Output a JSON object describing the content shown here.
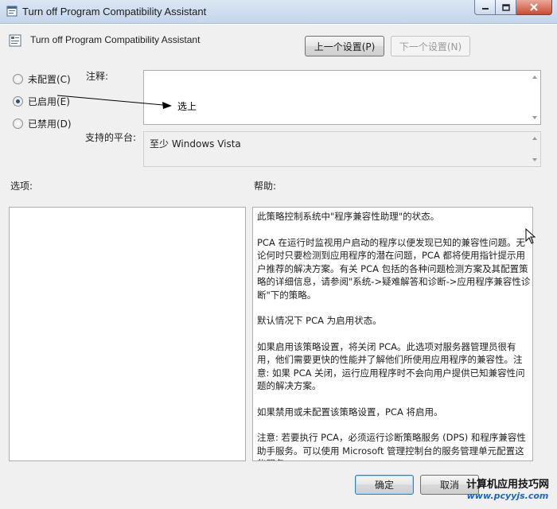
{
  "window": {
    "title": "Turn off Program Compatibility Assistant"
  },
  "header": {
    "policy_name": "Turn off Program Compatibility Assistant",
    "prev_button": "上一个设置(P)",
    "next_button": "下一个设置(N)"
  },
  "state_options": [
    {
      "label": "未配置(C)",
      "checked": false
    },
    {
      "label": "已启用(E)",
      "checked": true
    },
    {
      "label": "已禁用(D)",
      "checked": false
    }
  ],
  "comment": {
    "label": "注释:",
    "value": ""
  },
  "platform": {
    "label": "支持的平台:",
    "value": "至少 Windows Vista"
  },
  "options_section": {
    "label": "选项:"
  },
  "help_section": {
    "label": "帮助:",
    "paragraphs": [
      "此策略控制系统中\"程序兼容性助理\"的状态。",
      "PCA 在运行时监视用户启动的程序以便发现已知的兼容性问题。无论何时只要检测到应用程序的潜在问题，PCA 都将使用指针提示用户推荐的解决方案。有关 PCA 包括的各种问题检测方案及其配置策略的详细信息，请参阅\"系统->疑难解答和诊断->应用程序兼容性诊断\"下的策略。",
      "默认情况下 PCA 为启用状态。",
      "如果启用该策略设置，将关闭 PCA。此选项对服务器管理员很有用，他们需要更快的性能并了解他们所使用应用程序的兼容性。注意: 如果 PCA 关闭，运行应用程序时不会向用户提供已知兼容性问题的解决方案。",
      "如果禁用或未配置该策略设置，PCA 将启用。",
      "注意: 若要执行 PCA，必须运行诊断策略服务 (DPS) 和程序兼容性助手服务。可以使用 Microsoft 管理控制台的服务管理单元配置这些服务。"
    ]
  },
  "footer": {
    "ok_button": "确定",
    "cancel_button": "取消"
  },
  "annotation": {
    "text": "选上"
  },
  "watermark": {
    "title": "计算机应用技巧网",
    "url": "www.pcyyjs.com"
  },
  "icons": {
    "window": "policy-window-icon",
    "policy": "policy-setting-icon",
    "minimize": "minimize-icon",
    "maximize": "maximize-icon",
    "close": "close-icon",
    "cursor": "mouse-cursor-icon"
  }
}
